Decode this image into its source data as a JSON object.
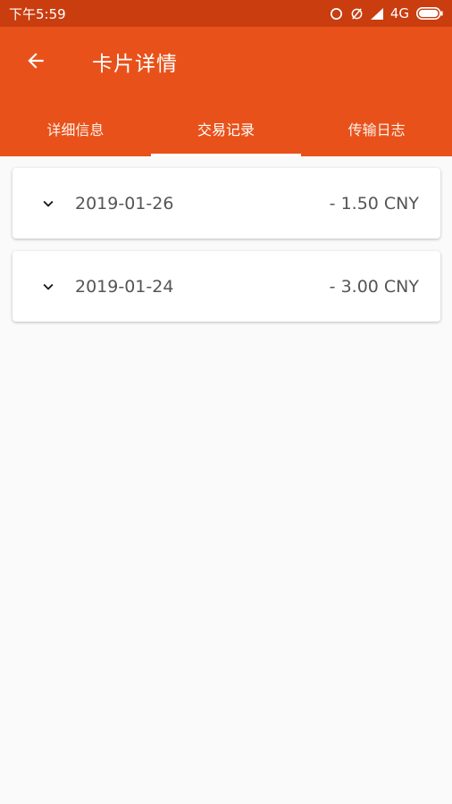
{
  "status_bar": {
    "time": "下午5:59",
    "network": "4G"
  },
  "header": {
    "title": "卡片详情"
  },
  "tabs": [
    {
      "label": "详细信息",
      "active": false
    },
    {
      "label": "交易记录",
      "active": true
    },
    {
      "label": "传输日志",
      "active": false
    }
  ],
  "transactions": [
    {
      "date": "2019-01-26",
      "amount": "- 1.50 CNY"
    },
    {
      "date": "2019-01-24",
      "amount": "- 3.00 CNY"
    }
  ],
  "colors": {
    "status_bar": "#c93d0f",
    "app_bar": "#e8521a",
    "background": "#fafafa"
  },
  "icons": [
    "back-arrow-icon",
    "chevron-down-icon",
    "sync-icon",
    "mute-icon",
    "signal-icon",
    "battery-icon"
  ]
}
